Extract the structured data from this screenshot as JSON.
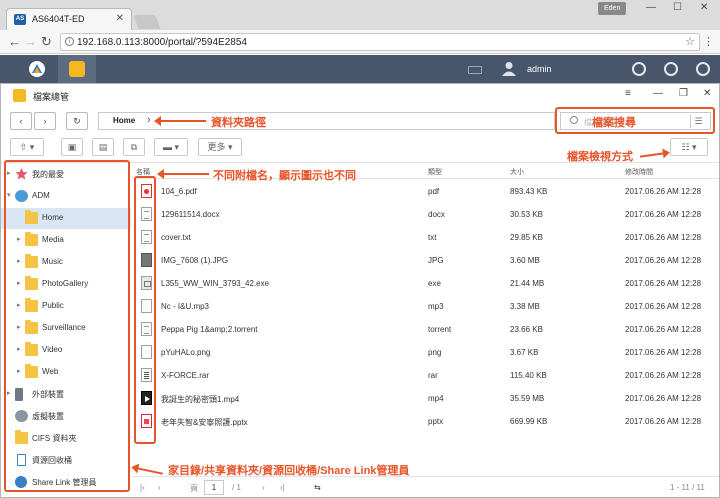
{
  "browser": {
    "tab_title": "AS6404T-ED",
    "tab_favicon_text": "AS",
    "user_chip": "Eden",
    "url": "192.168.0.113:8000/portal/?594E2854"
  },
  "adm_bar": {
    "username": "admin"
  },
  "app": {
    "title": "檔案總管",
    "breadcrumb_home": "Home",
    "search_placeholder": "檔案搜尋",
    "toolbar_more": "更多"
  },
  "sidebar": {
    "items": [
      {
        "label": "我的最愛",
        "icon": "star-icon"
      },
      {
        "label": "ADM",
        "icon": "adm-icon"
      },
      {
        "label": "Home",
        "icon": "folder-icon"
      },
      {
        "label": "Media",
        "icon": "folder-icon"
      },
      {
        "label": "Music",
        "icon": "folder-icon"
      },
      {
        "label": "PhotoGallery",
        "icon": "folder-icon"
      },
      {
        "label": "Public",
        "icon": "folder-icon"
      },
      {
        "label": "Surveillance",
        "icon": "folder-icon"
      },
      {
        "label": "Video",
        "icon": "folder-icon"
      },
      {
        "label": "Web",
        "icon": "folder-icon"
      },
      {
        "label": "外部裝置",
        "icon": "usb-icon"
      },
      {
        "label": "虛擬裝置",
        "icon": "virtual-device-icon"
      },
      {
        "label": "CIFS 資料夾",
        "icon": "cifs-folder-icon"
      },
      {
        "label": "資源回收桶",
        "icon": "recycle-bin-icon"
      },
      {
        "label": "Share Link 管理員",
        "icon": "share-link-icon"
      }
    ]
  },
  "columns": {
    "name": "名稱",
    "type": "類型",
    "size": "大小",
    "modified": "修改時間"
  },
  "files": [
    {
      "name": "104_6.pdf",
      "type": "pdf",
      "size": "893.43 KB",
      "modified": "2017.06.26 AM 12:28",
      "icon": "pdf-file-icon"
    },
    {
      "name": "129611514.docx",
      "type": "docx",
      "size": "30.53 KB",
      "modified": "2017.06.26 AM 12:28",
      "icon": "docx-file-icon"
    },
    {
      "name": "cover.txt",
      "type": "txt",
      "size": "29.85 KB",
      "modified": "2017.06.26 AM 12:28",
      "icon": "txt-file-icon"
    },
    {
      "name": "IMG_7608 (1).JPG",
      "type": "JPG",
      "size": "3.60 MB",
      "modified": "2017.06.26 AM 12:28",
      "icon": "image-file-icon"
    },
    {
      "name": "L355_WW_WIN_3793_42.exe",
      "type": "exe",
      "size": "21.44 MB",
      "modified": "2017.06.26 AM 12:28",
      "icon": "exe-file-icon"
    },
    {
      "name": "Nc - I&U.mp3",
      "type": "mp3",
      "size": "3.38 MB",
      "modified": "2017.06.26 AM 12:28",
      "icon": "audio-file-icon"
    },
    {
      "name": "Peppa Pig 1&amp;2.torrent",
      "type": "torrent",
      "size": "23.66 KB",
      "modified": "2017.06.26 AM 12:28",
      "icon": "torrent-file-icon"
    },
    {
      "name": "pYuHALo.png",
      "type": "png",
      "size": "3.67 KB",
      "modified": "2017.06.26 AM 12:28",
      "icon": "png-file-icon"
    },
    {
      "name": "X-FORCE.rar",
      "type": "rar",
      "size": "115.40 KB",
      "modified": "2017.06.26 AM 12:28",
      "icon": "rar-file-icon"
    },
    {
      "name": "我誕生的秘密頭1.mp4",
      "type": "mp4",
      "size": "35.59 MB",
      "modified": "2017.06.26 AM 12:28",
      "icon": "video-file-icon"
    },
    {
      "name": "老年失智&安寧照護.pptx",
      "type": "pptx",
      "size": "669.99 KB",
      "modified": "2017.06.26 AM 12:28",
      "icon": "pptx-file-icon"
    }
  ],
  "pager": {
    "page_label": "頁",
    "page": "1",
    "total": "/ 1",
    "range": "1 - 11 / 11"
  },
  "annotations": {
    "breadcrumb": "資料夾路徑",
    "search": "檔案搜尋",
    "view_mode": "檔案檢視方式",
    "icons": "不同附檔名，顯示圖示也不同",
    "sidebar": "家目錄/共享資料夾/資源回收桶/Share Link管理員"
  },
  "colors": {
    "annotation": "#e8542a",
    "adm_bar": "#47566a",
    "selected": "#d9e6f4"
  }
}
